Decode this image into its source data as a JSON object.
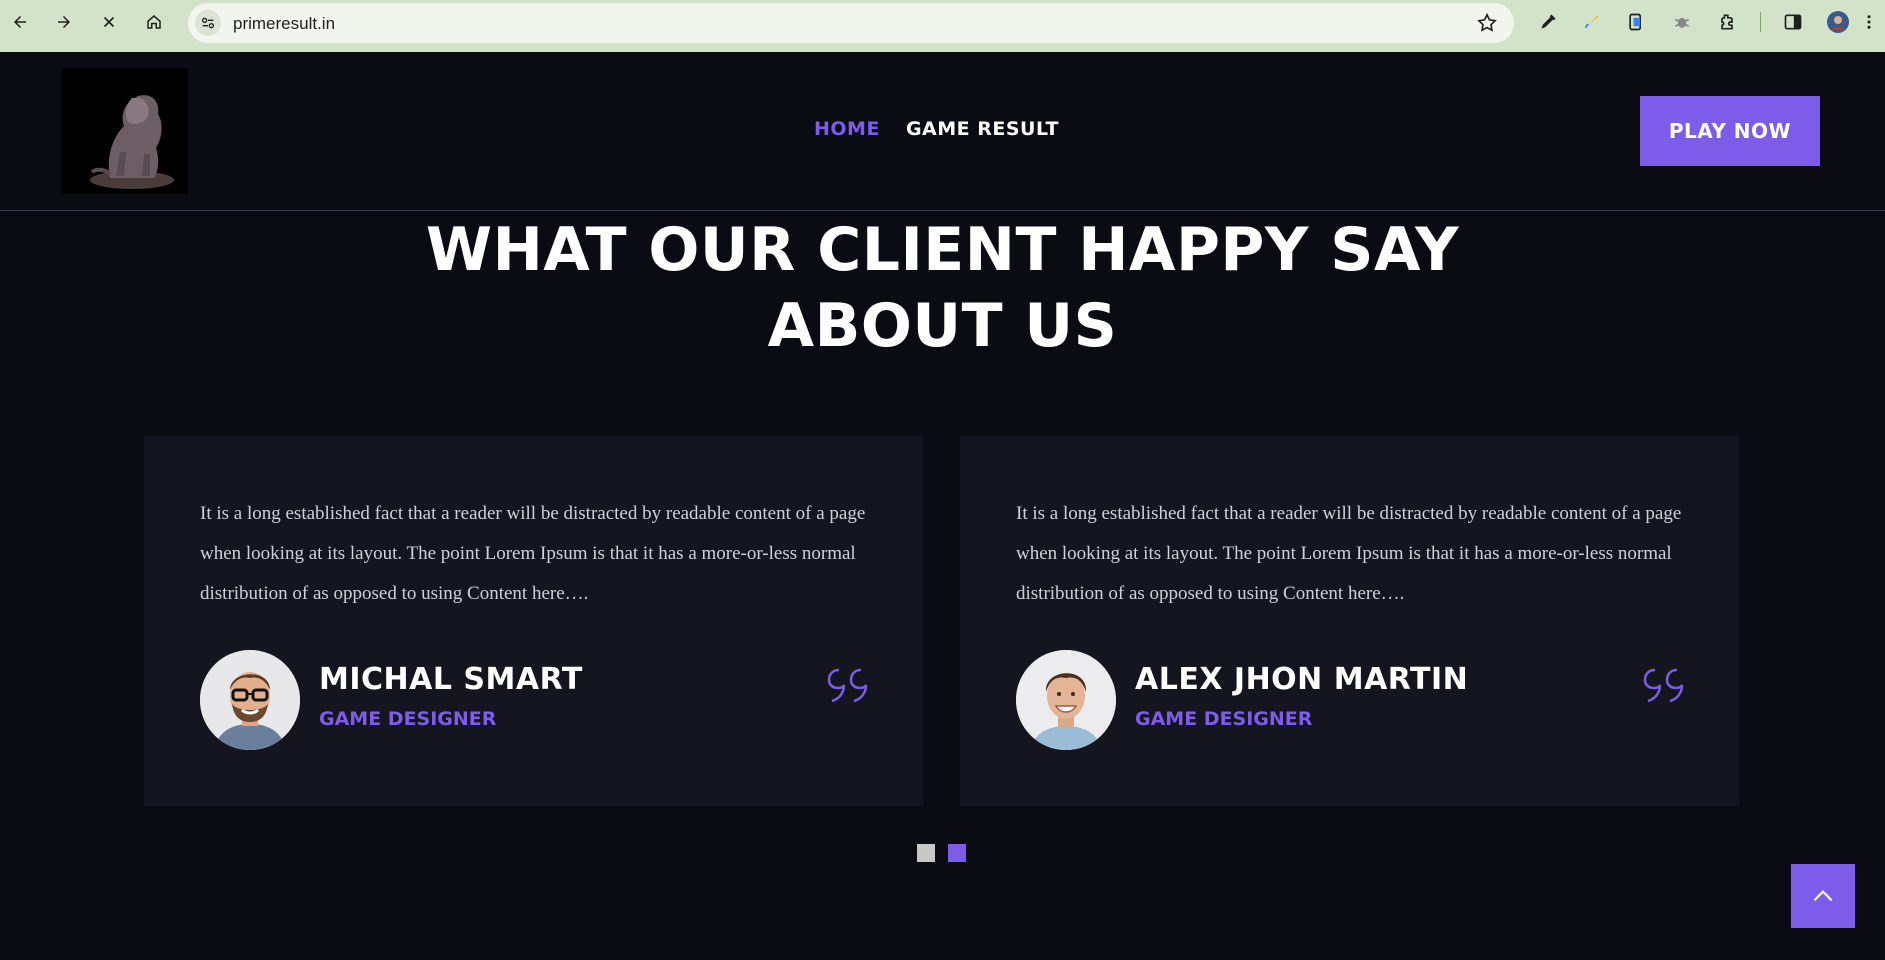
{
  "browser": {
    "url": "primeresult.in"
  },
  "header": {
    "nav": [
      {
        "label": "HOME",
        "active": true
      },
      {
        "label": "GAME RESULT",
        "active": false
      }
    ],
    "cta_label": "PLAY NOW"
  },
  "section": {
    "title_line1": "WHAT OUR CLIENT HAPPY SAY",
    "title_line2": "ABOUT US"
  },
  "testimonials": [
    {
      "text": "It is a long established fact that a reader will be distracted by readable content of a page when looking at its layout. The point Lorem Ipsum is that it has a more-or-less normal distribution of as opposed to using Content here….",
      "name": "MICHAL SMART",
      "role": "GAME DESIGNER"
    },
    {
      "text": "It is a long established fact that a reader will be distracted by readable content of a page when looking at its layout. The point Lorem Ipsum is that it has a more-or-less normal distribution of as opposed to using Content here….",
      "name": "ALEX JHON MARTIN",
      "role": "GAME DESIGNER"
    }
  ],
  "slider": {
    "dot_count": 2,
    "active_index": 1
  },
  "colors": {
    "accent": "#7c5ce8",
    "background": "#0b0c13",
    "card": "#15151f",
    "chrome": "#d3e3c9"
  }
}
